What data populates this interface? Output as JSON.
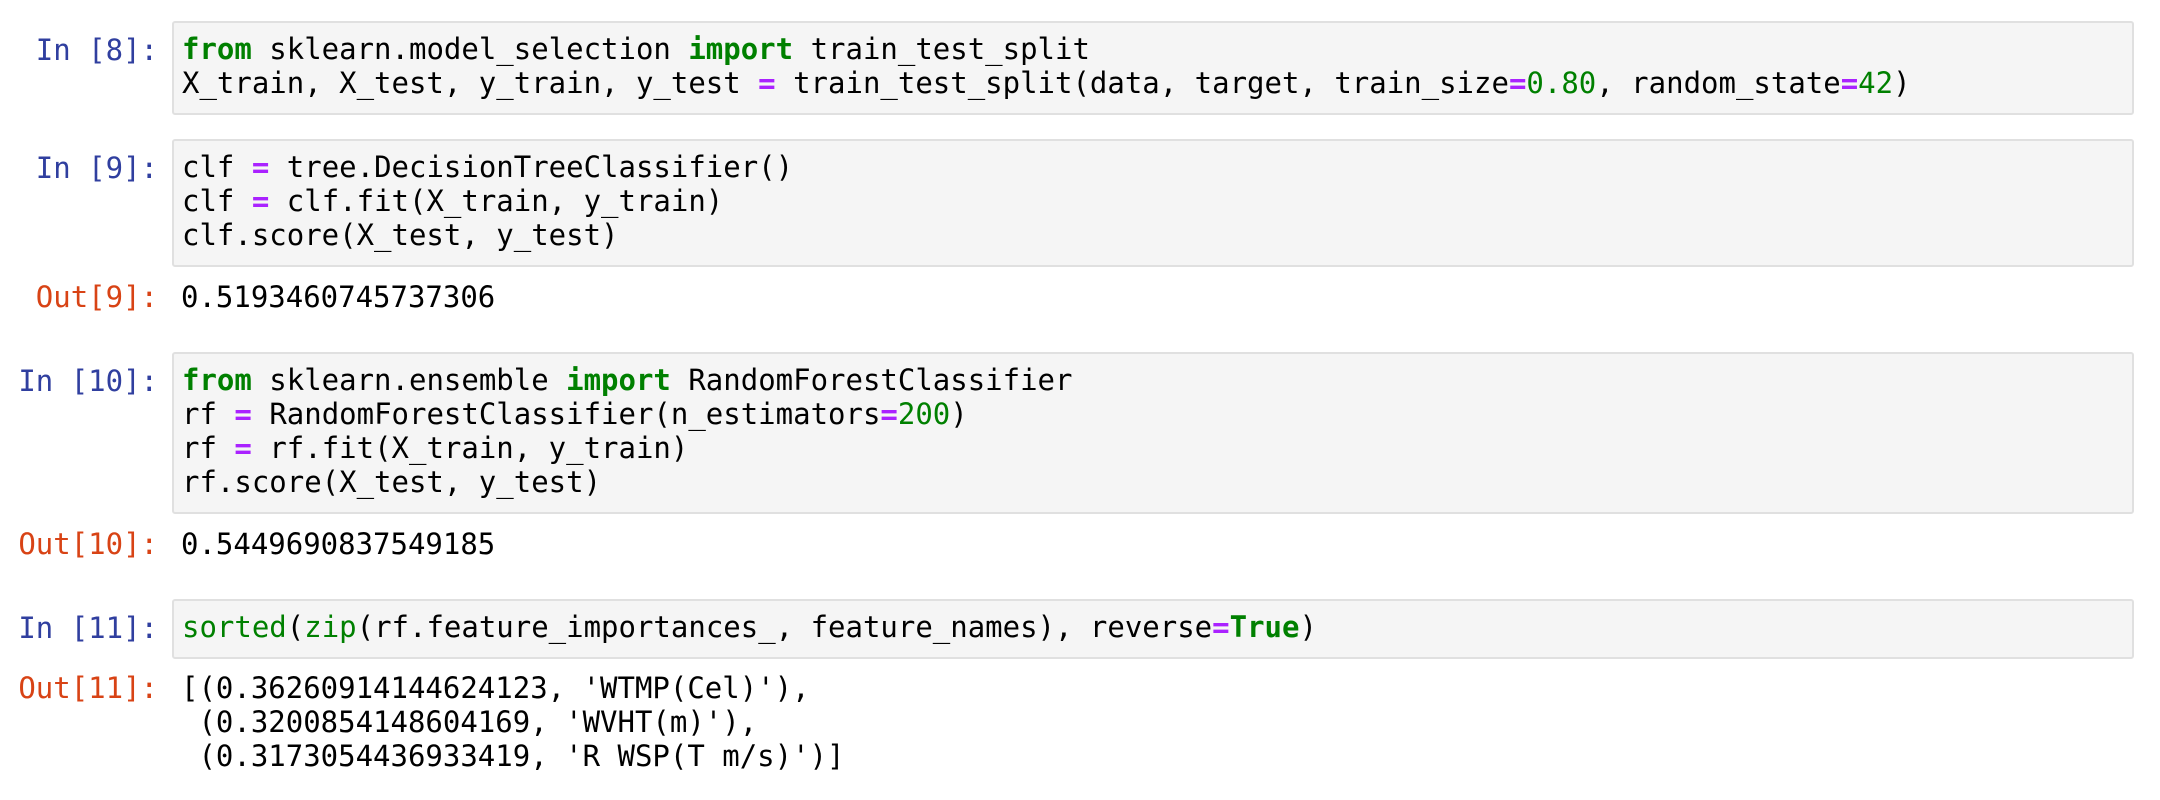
{
  "cells": [
    {
      "in_prompt": "In [8]:",
      "code": [
        [
          {
            "t": "from",
            "c": "kw"
          },
          {
            "t": " sklearn.model_selection ",
            "c": ""
          },
          {
            "t": "import",
            "c": "kw"
          },
          {
            "t": " train_test_split",
            "c": ""
          }
        ],
        [
          {
            "t": "X_train, X_test, y_train, y_test ",
            "c": ""
          },
          {
            "t": "=",
            "c": "op"
          },
          {
            "t": " train_test_split(data, target, train_size",
            "c": ""
          },
          {
            "t": "=",
            "c": "op"
          },
          {
            "t": "0.80",
            "c": "num"
          },
          {
            "t": ", random_state",
            "c": ""
          },
          {
            "t": "=",
            "c": "op"
          },
          {
            "t": "42",
            "c": "num"
          },
          {
            "t": ")",
            "c": ""
          }
        ]
      ]
    },
    {
      "in_prompt": "In [9]:",
      "code": [
        [
          {
            "t": "clf ",
            "c": ""
          },
          {
            "t": "=",
            "c": "op"
          },
          {
            "t": " tree.DecisionTreeClassifier()",
            "c": ""
          }
        ],
        [
          {
            "t": "clf ",
            "c": ""
          },
          {
            "t": "=",
            "c": "op"
          },
          {
            "t": " clf.fit(X_train, y_train)",
            "c": ""
          }
        ],
        [
          {
            "t": "clf.score(X_test, y_test)",
            "c": ""
          }
        ]
      ],
      "out_prompt": "Out[9]:",
      "output": [
        "0.5193460745737306"
      ]
    },
    {
      "in_prompt": "In [10]:",
      "code": [
        [
          {
            "t": "from",
            "c": "kw"
          },
          {
            "t": " sklearn.ensemble ",
            "c": ""
          },
          {
            "t": "import",
            "c": "kw"
          },
          {
            "t": " RandomForestClassifier",
            "c": ""
          }
        ],
        [
          {
            "t": "rf ",
            "c": ""
          },
          {
            "t": "=",
            "c": "op"
          },
          {
            "t": " RandomForestClassifier(n_estimators",
            "c": ""
          },
          {
            "t": "=",
            "c": "op"
          },
          {
            "t": "200",
            "c": "num"
          },
          {
            "t": ")",
            "c": ""
          }
        ],
        [
          {
            "t": "rf ",
            "c": ""
          },
          {
            "t": "=",
            "c": "op"
          },
          {
            "t": " rf.fit(X_train, y_train)",
            "c": ""
          }
        ],
        [
          {
            "t": "rf.score(X_test, y_test)",
            "c": ""
          }
        ]
      ],
      "out_prompt": "Out[10]:",
      "output": [
        "0.5449690837549185"
      ]
    },
    {
      "in_prompt": "In [11]:",
      "code": [
        [
          {
            "t": "sorted",
            "c": "bi"
          },
          {
            "t": "(",
            "c": ""
          },
          {
            "t": "zip",
            "c": "bi"
          },
          {
            "t": "(rf.feature_importances_, feature_names), reverse",
            "c": ""
          },
          {
            "t": "=",
            "c": "op"
          },
          {
            "t": "True",
            "c": "kw"
          },
          {
            "t": ")",
            "c": ""
          }
        ]
      ],
      "out_prompt": "Out[11]:",
      "output": [
        "[(0.36260914144624123, 'WTMP(Cel)'),",
        " (0.3200854148604169, 'WVHT(m)'),",
        " (0.3173054436933419, 'R WSP(T m/s)')]"
      ]
    }
  ],
  "colors": {
    "in_prompt": "#303f9f",
    "out_prompt": "#d84315",
    "keyword": "#008000",
    "operator": "#aa22ff",
    "input_bg": "#f5f5f5",
    "input_border": "#e0e0e0"
  }
}
